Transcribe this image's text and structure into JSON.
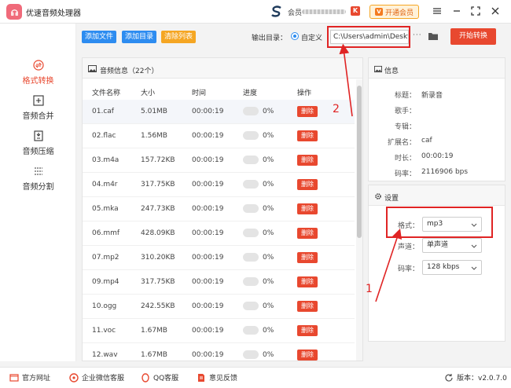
{
  "app": {
    "title": "优速音频处理器",
    "account_label": "会员",
    "vip_label": "开通会员",
    "vip_icon_text": "V"
  },
  "sidebar": {
    "items": [
      {
        "label": "格式转换",
        "icon": "format-convert-icon",
        "active": true
      },
      {
        "label": "音频合并",
        "icon": "merge-icon",
        "active": false
      },
      {
        "label": "音频压缩",
        "icon": "compress-icon",
        "active": false
      },
      {
        "label": "音频分割",
        "icon": "split-icon",
        "active": false
      }
    ]
  },
  "toolbar": {
    "add_file": "添加文件",
    "add_dir": "添加目录",
    "clear_list": "清除列表",
    "output_label": "输出目录：",
    "custom_option": "自定义",
    "path_value": "C:\\Users\\admin\\Deskto",
    "browse_dots": "···",
    "start_label": "开始转换"
  },
  "file_panel": {
    "header": "音频信息（22个）",
    "columns": [
      "文件名称",
      "大小",
      "时间",
      "进度",
      "操作"
    ],
    "delete_label": "删除",
    "rows": [
      {
        "name": "01.caf",
        "size": "5.01MB",
        "time": "00:00:19",
        "progress": "0%"
      },
      {
        "name": "02.flac",
        "size": "1.56MB",
        "time": "00:00:19",
        "progress": "0%"
      },
      {
        "name": "03.m4a",
        "size": "157.72KB",
        "time": "00:00:19",
        "progress": "0%"
      },
      {
        "name": "04.m4r",
        "size": "317.75KB",
        "time": "00:00:19",
        "progress": "0%"
      },
      {
        "name": "05.mka",
        "size": "247.73KB",
        "time": "00:00:19",
        "progress": "0%"
      },
      {
        "name": "06.mmf",
        "size": "428.09KB",
        "time": "00:00:19",
        "progress": "0%"
      },
      {
        "name": "07.mp2",
        "size": "310.20KB",
        "time": "00:00:19",
        "progress": "0%"
      },
      {
        "name": "09.mp4",
        "size": "317.75KB",
        "time": "00:00:19",
        "progress": "0%"
      },
      {
        "name": "10.ogg",
        "size": "242.55KB",
        "time": "00:00:19",
        "progress": "0%"
      },
      {
        "name": "11.voc",
        "size": "1.67MB",
        "time": "00:00:19",
        "progress": "0%"
      },
      {
        "name": "12.wav",
        "size": "1.67MB",
        "time": "00:00:19",
        "progress": "0%"
      }
    ]
  },
  "info": {
    "header": "信息",
    "fields": [
      {
        "label": "标题：",
        "value": "新录音"
      },
      {
        "label": "歌手：",
        "value": ""
      },
      {
        "label": "专辑：",
        "value": ""
      },
      {
        "label": "扩展名：",
        "value": "caf"
      },
      {
        "label": "时长：",
        "value": "00:00:19"
      },
      {
        "label": "码率：",
        "value": "2116906 bps"
      }
    ]
  },
  "settings": {
    "header": "设置",
    "format_label": "格式：",
    "format_value": "mp3",
    "channel_label": "声道：",
    "channel_value": "单声道",
    "bitrate_label": "码率：",
    "bitrate_value": "128 kbps"
  },
  "footer": {
    "website": "官方网址",
    "wechat": "企业微信客服",
    "qq": "QQ客服",
    "feedback": "意见反馈",
    "version": "版本：v2.0.7.0"
  },
  "annotations": {
    "number_1": "1",
    "number_2": "2"
  },
  "colors": {
    "accent": "#e8482f",
    "blue": "#2d8cf0",
    "orange": "#f5a623"
  }
}
